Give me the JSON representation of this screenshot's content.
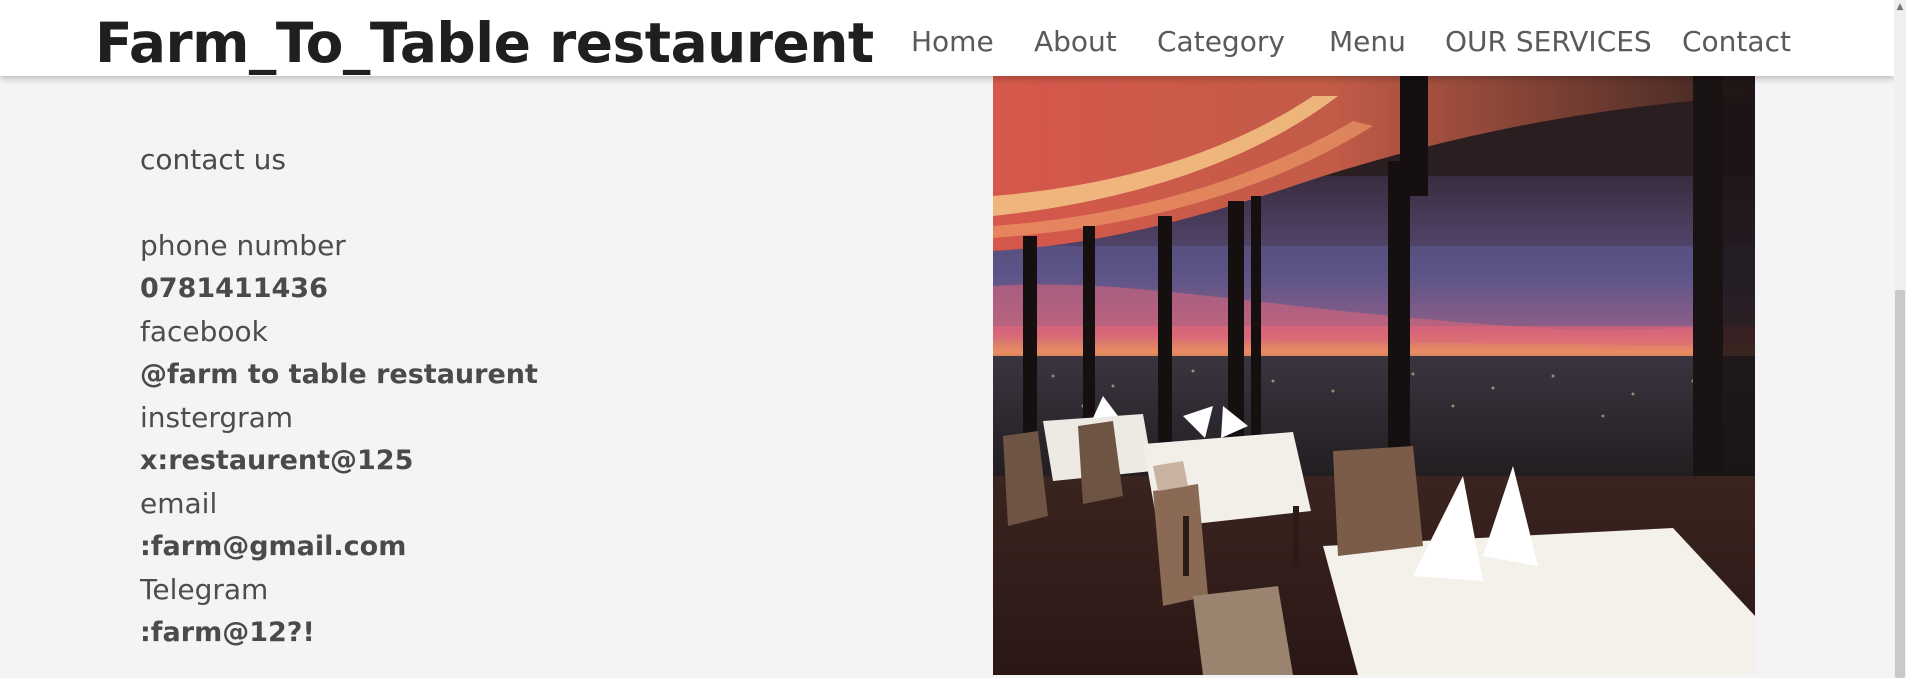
{
  "header": {
    "logo": "Farm_To_Table restaurent",
    "nav": {
      "home": "Home",
      "about": "About",
      "category": "Category",
      "menu": "Menu",
      "services": "OUR SERVICES",
      "contact": "Contact"
    }
  },
  "contact": {
    "title": "contact us",
    "items": [
      {
        "label": "phone number",
        "value": "0781411436"
      },
      {
        "label": "facebook",
        "value": "@farm to table restaurent"
      },
      {
        "label": "instergram",
        "value": "x:restaurent@125"
      },
      {
        "label": "email",
        "value": ":farm@gmail.com"
      },
      {
        "label": "Telegram",
        "value": ":farm@12?!"
      }
    ]
  },
  "photo": {
    "subject": "restaurant dining room with city view at dusk"
  },
  "colors": {
    "background": "#f4f4f6",
    "header_bg": "#ffffff",
    "logo": "#1f1f1f",
    "nav_text": "#5a5a5a",
    "body_text": "#4a4a4a"
  }
}
